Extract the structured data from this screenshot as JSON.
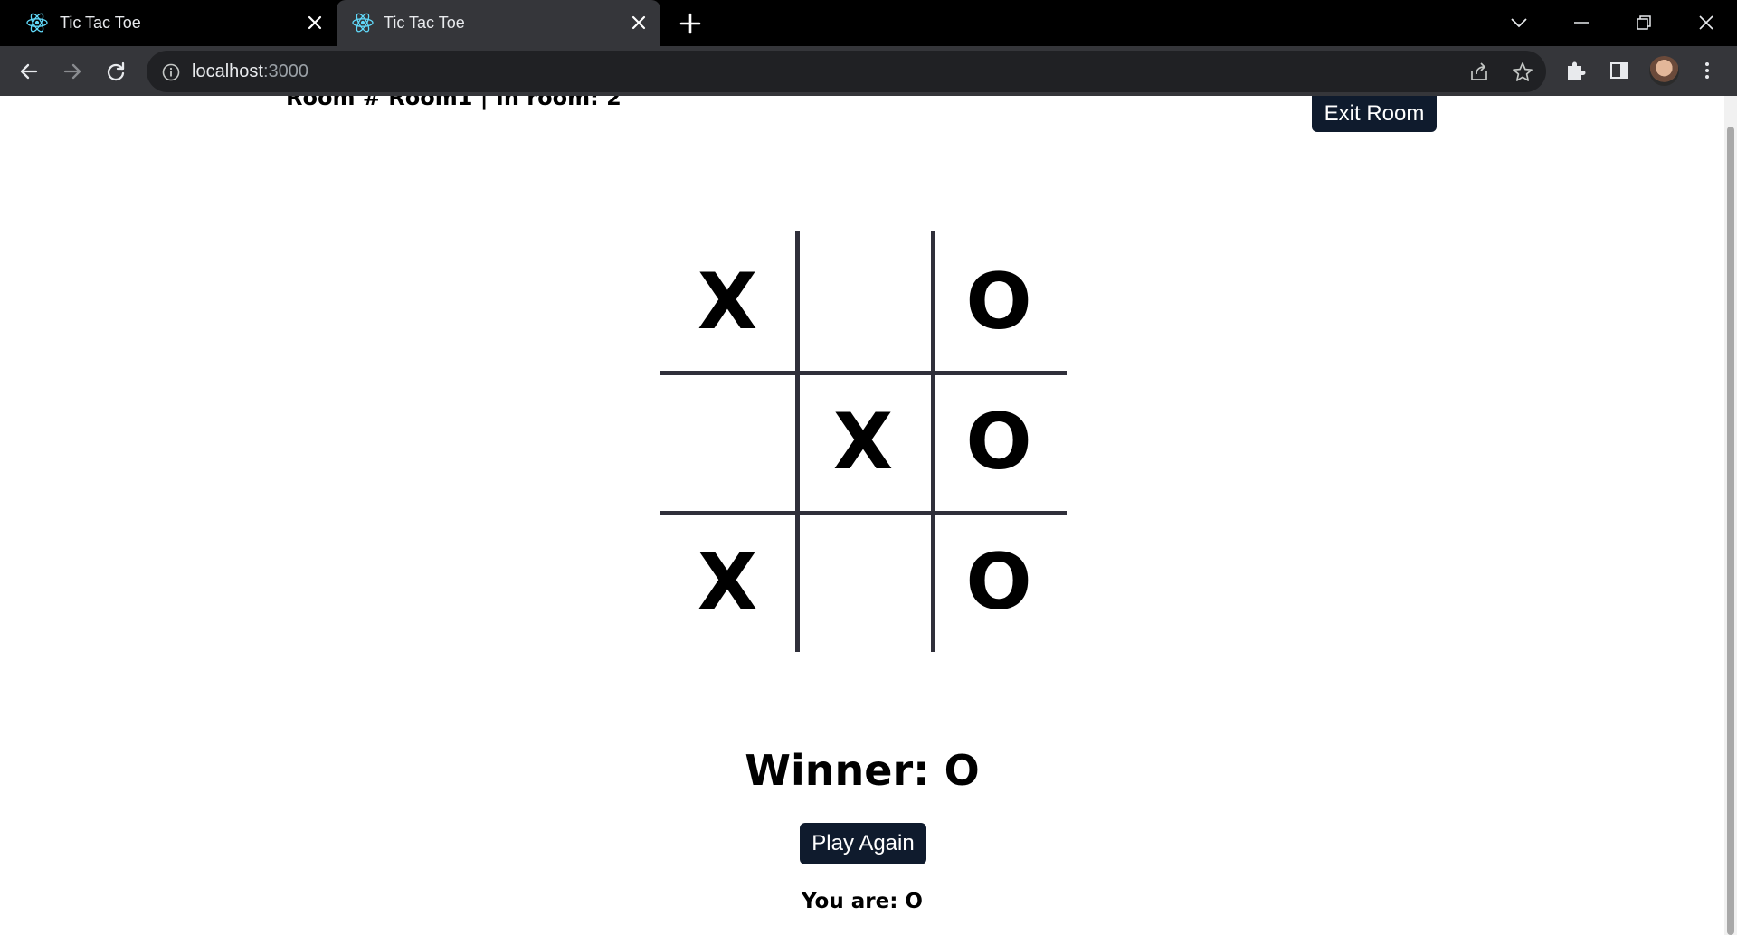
{
  "browser": {
    "tabs": [
      {
        "title": "Tic Tac Toe",
        "active": false
      },
      {
        "title": "Tic Tac Toe",
        "active": true
      }
    ],
    "url": {
      "host": "localhost",
      "port": ":3000"
    }
  },
  "game": {
    "room_info": "Room # Room1 | In room: 2",
    "exit_label": "Exit Room",
    "board": [
      [
        "X",
        "",
        "O"
      ],
      [
        "",
        "X",
        "O"
      ],
      [
        "X",
        "",
        "O"
      ]
    ],
    "winner_text": "Winner: O",
    "play_again_label": "Play Again",
    "you_are_text": "You are: O"
  },
  "colors": {
    "chrome_bg": "#000000",
    "active_tab": "#35363a",
    "button_bg": "#0f1b2d",
    "grid_line": "#2f2f3a"
  }
}
